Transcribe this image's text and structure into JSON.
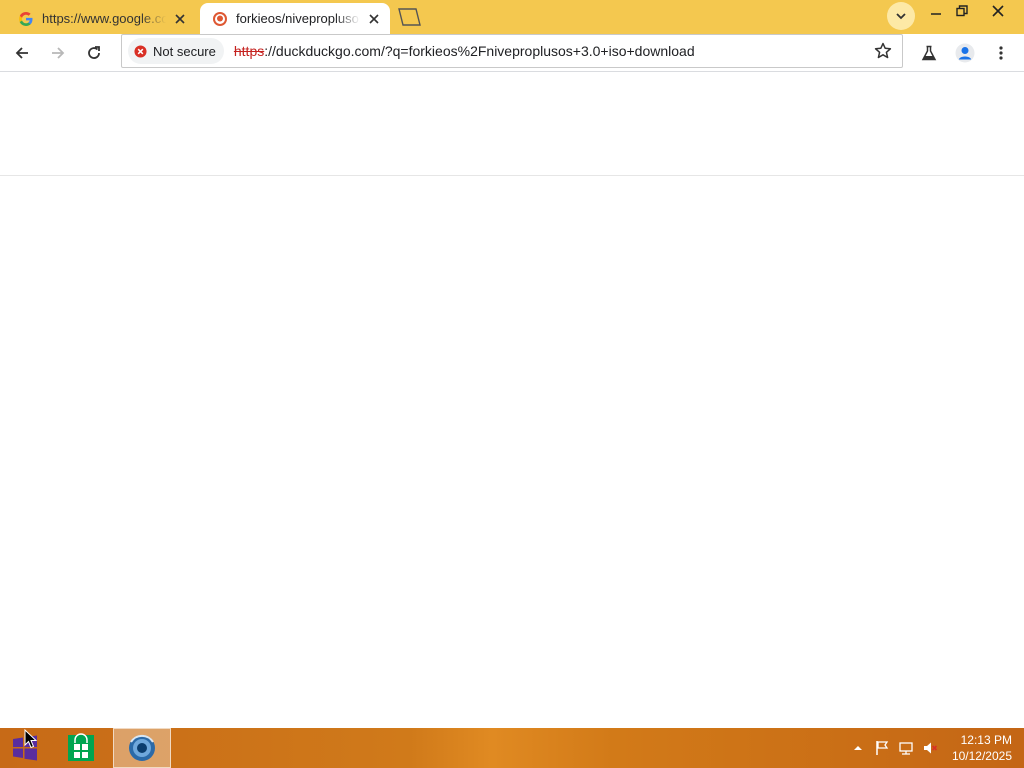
{
  "browser": {
    "tabs": [
      {
        "title": "https://www.google.com/",
        "favicon": "google-g-icon",
        "active": false
      },
      {
        "title": "forkieos/niveproplusos",
        "favicon": "duckduckgo-icon",
        "active": true
      }
    ],
    "omnibox": {
      "security_label": "Not secure",
      "url_scheme": "https",
      "url_rest": "://duckduckgo.com/?q=forkieos%2Fniveproplusos+3.0+iso+download"
    },
    "tab_strip_color": "#f4c84f"
  },
  "taskbar": {
    "apps": [
      "store-icon",
      "chrome-icon"
    ],
    "clock": {
      "time": "12:13 PM",
      "date": "10/12/2025"
    }
  }
}
